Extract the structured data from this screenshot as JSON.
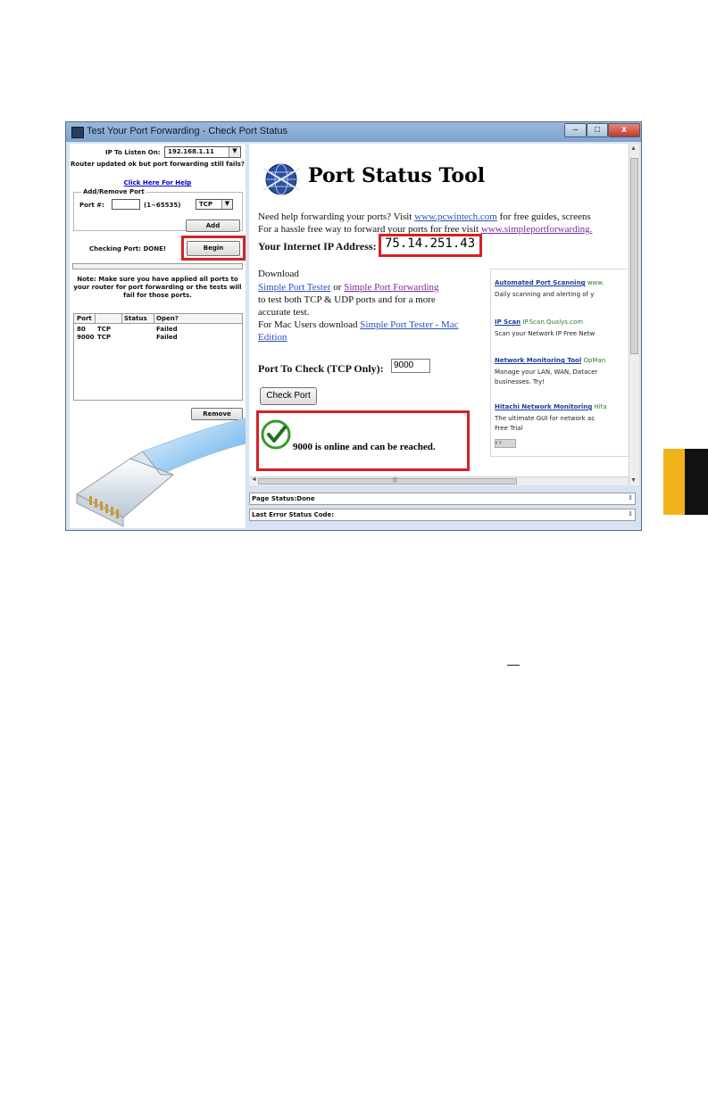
{
  "window": {
    "title": "Test Your Port Forwarding - Check Port Status",
    "min_glyph": "–",
    "max_glyph": "□",
    "close_glyph": "x"
  },
  "left_panel": {
    "ip_label": "IP To Listen On:",
    "ip_value": "192.168.1.11",
    "router_msg": "Router updated ok but port forwarding still fails?",
    "help_link": "Click Here For Help",
    "group_title": "Add/Remove Port",
    "port_label": "Port #:",
    "port_value": "",
    "port_range": "(1~65535)",
    "protocol_value": "TCP",
    "add_label": "Add",
    "checking_status": "Checking Port: DONE!",
    "begin_label": "Begin",
    "note": "Note: Make sure you have applied all ports to your router for port forwarding or the tests will fail for those ports.",
    "table": {
      "headers": [
        "Port",
        "",
        "Status",
        "Open?"
      ],
      "rows": [
        {
          "port": "80",
          "proto": "TCP",
          "status": "",
          "open": "Failed"
        },
        {
          "port": "9000",
          "proto": "TCP",
          "status": "",
          "open": "Failed"
        }
      ]
    },
    "remove_label": "Remove"
  },
  "browser": {
    "brand_title": "Port Status Tool",
    "help_line1_prefix": "Need help forwarding your ports? Visit ",
    "help_line1_link": "www.pcwintech.com",
    "help_line1_suffix": " for free guides, screens",
    "help_line2_prefix": "For a hassle free way to forward your ports for free visit ",
    "help_line2_link": "www.simpleportforwarding.",
    "ip_label": "Your Internet IP Address:",
    "ip_value": "75.14.251.43",
    "download_label": "Download",
    "download_link1": "Simple Port Tester",
    "download_or": " or ",
    "download_link2": "Simple Port Forwarding",
    "download_line3": "to test both TCP & UDP ports and for a more",
    "download_line4": "accurate test.",
    "mac_prefix": "For Mac Users download ",
    "mac_link_a": "Simple Port Tester - Mac",
    "mac_link_b": "Edition",
    "port_check_label": "Port To Check (TCP Only):",
    "port_check_value": "9000",
    "check_button": "Check Port",
    "result_text": "9000 is online and can be reached.",
    "ads": [
      {
        "title": "Automated Port Scanning",
        "url": "www.",
        "desc1": "Daily scanning and alerting of y",
        "desc2": ""
      },
      {
        "title": "IP Scan",
        "url": "IP.Scan.Qualys.com",
        "desc1": "Scan your Network IP Free Netw",
        "desc2": ""
      },
      {
        "title": "Network Monitoring Tool",
        "url": "OpMan",
        "desc1": "Manage your LAN, WAN, Datacer",
        "desc2": "businesses. Try!"
      },
      {
        "title": "Hitachi Network Monitoring",
        "url": "Hita",
        "desc1": "The ultimate GUI for network ac",
        "desc2": "Free Trial"
      }
    ],
    "ad_nav": "‹ ›"
  },
  "status": {
    "page_status": "Page Status:Done",
    "last_error": "Last Error Status Code:"
  },
  "colors": {
    "highlight": "#d52127",
    "page_tab": "#f1b31c",
    "link": "#2a4fbf",
    "visited_link": "#7a2b96"
  },
  "icons": [
    "app-icon",
    "globe-icon",
    "checkmark-icon",
    "ethernet-cable-icon",
    "dropdown-arrow-icon",
    "scroll-arrow-icon"
  ]
}
